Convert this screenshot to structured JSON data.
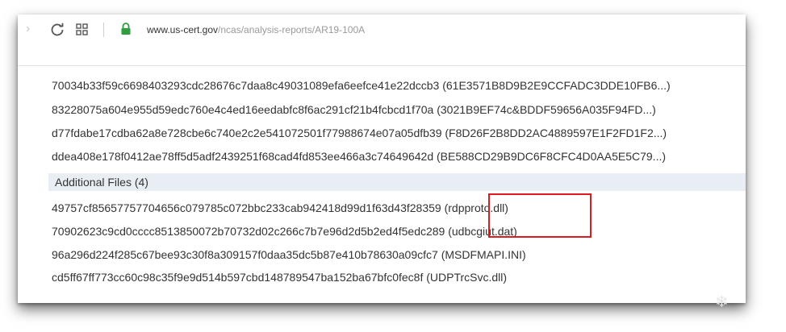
{
  "browser": {
    "url_host": "www.us-cert.gov",
    "url_path": "/ncas/analysis-reports/AR19-100A"
  },
  "hash_rows": [
    {
      "hash": "70034b33f59c6698403293cdc28676c7daa8c49031089efa6eefce41e22dccb3",
      "label": "(61E3571B8D9B2E9CCFADC3DDE10FB6...)"
    },
    {
      "hash": "83228075a604e955d59edc760e4c4ed16eedabfc8f6ac291cf21b4fcbcd1f70a",
      "label": "(3021B9EF74c&BDDF59656A035F94FD...)"
    },
    {
      "hash": "d77fdabe17cdba62a8e728cbe6c740e2c2e541072501f77988674e07a05dfb39",
      "label": "(F8D26F2B8DD2AC4889597E1F2FD1F2...)"
    },
    {
      "hash": "ddea408e178f0412ae78ff5d5adf2439251f68cad4fd853ee466a3c74649642d",
      "label": "(BE588CD29B9DC6F8CFC4D0AA5E5C79...)"
    }
  ],
  "additional_files": {
    "header": "Additional Files (4)",
    "rows": [
      {
        "hash": "49757cf85657757704656c079785c072bbc233cab942418d99d1f63d43f28359",
        "label": "(rdpproto.dll)"
      },
      {
        "hash": "70902623c9cd0cccc8513850072b70732d02c266c7b7e96d2d5b2ed4f5edc289",
        "label": "(udbcgiut.dat)"
      },
      {
        "hash": "96a296d224f285c67bee93c30f8a309157f0daa35dc5b87e410b78630a09cfc7",
        "label": "(MSDFMAPI.INI)"
      },
      {
        "hash": "cd5ff67ff773cc60c98c35f9e9d514b597cbd148789547ba152ba67bfc0fec8f",
        "label": "(UDPTrcSvc.dll)"
      }
    ]
  },
  "colors": {
    "highlight_border": "#e0191e",
    "section_header_bg": "#e9eef5",
    "lock_green": "#2e9e3e"
  },
  "icons": [
    "forward-icon",
    "reload-icon",
    "apps-icon",
    "lock-icon"
  ]
}
